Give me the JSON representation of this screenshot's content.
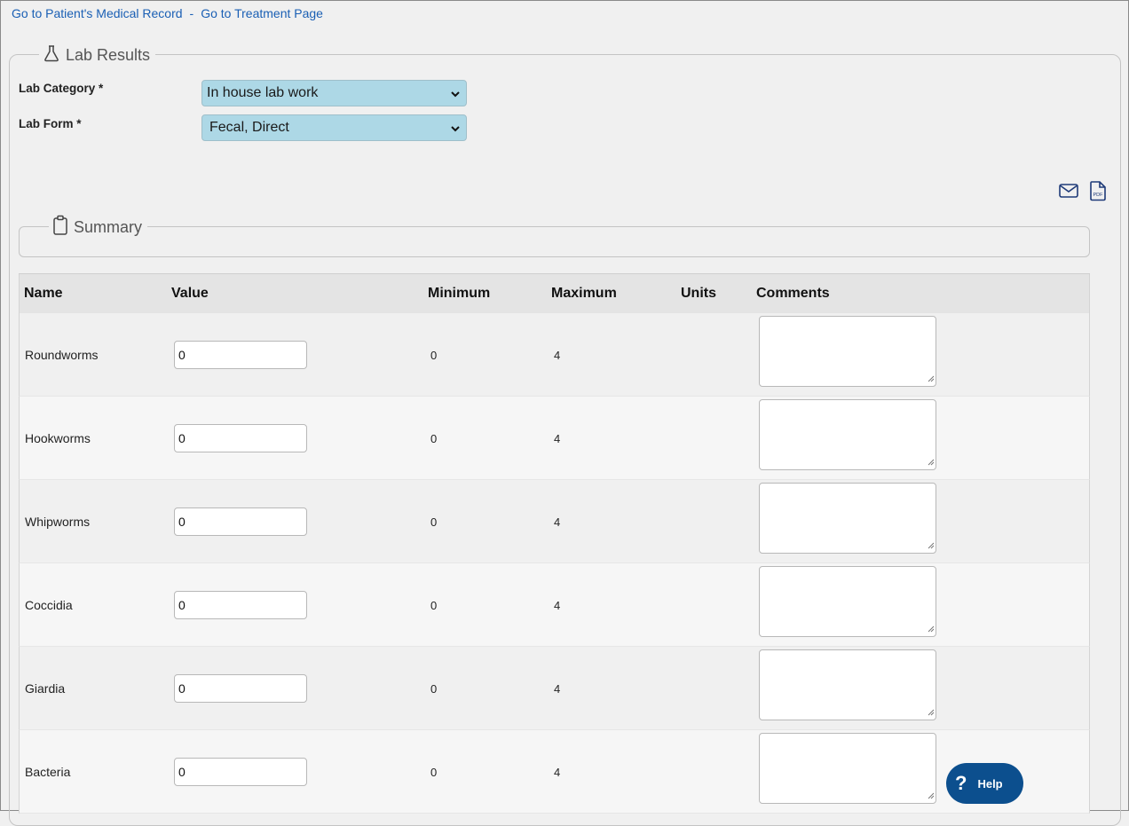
{
  "nav": {
    "link_medical_record": "Go to Patient's Medical Record",
    "separator": "-",
    "link_treatment": "Go to Treatment Page"
  },
  "lab_results": {
    "title": "Lab Results",
    "icon": "flask-icon",
    "category_label": "Lab Category *",
    "category_value": "In house lab work",
    "form_label": "Lab Form *",
    "form_value": "Fecal, Direct"
  },
  "actions": {
    "email_icon": "envelope-icon",
    "pdf_icon": "pdf-icon",
    "pdf_text": "PDF"
  },
  "summary": {
    "title": "Summary",
    "icon": "clipboard-icon"
  },
  "table": {
    "headers": [
      "Name",
      "Value",
      "Minimum",
      "Maximum",
      "Units",
      "Comments"
    ],
    "rows": [
      {
        "name": "Roundworms",
        "value": "0",
        "min": "0",
        "max": "4",
        "units": "",
        "comment": ""
      },
      {
        "name": "Hookworms",
        "value": "0",
        "min": "0",
        "max": "4",
        "units": "",
        "comment": ""
      },
      {
        "name": "Whipworms",
        "value": "0",
        "min": "0",
        "max": "4",
        "units": "",
        "comment": ""
      },
      {
        "name": "Coccidia",
        "value": "0",
        "min": "0",
        "max": "4",
        "units": "",
        "comment": ""
      },
      {
        "name": "Giardia",
        "value": "0",
        "min": "0",
        "max": "4",
        "units": "",
        "comment": ""
      },
      {
        "name": "Bacteria",
        "value": "0",
        "min": "0",
        "max": "4",
        "units": "",
        "comment": ""
      }
    ]
  },
  "help": {
    "label": "Help",
    "icon": "question-icon",
    "glyph": "?"
  },
  "colors": {
    "link": "#1a5fb4",
    "select_bg": "#add8e6",
    "help_bg": "#0c4f8e",
    "icon_blue": "#1e3a78"
  }
}
